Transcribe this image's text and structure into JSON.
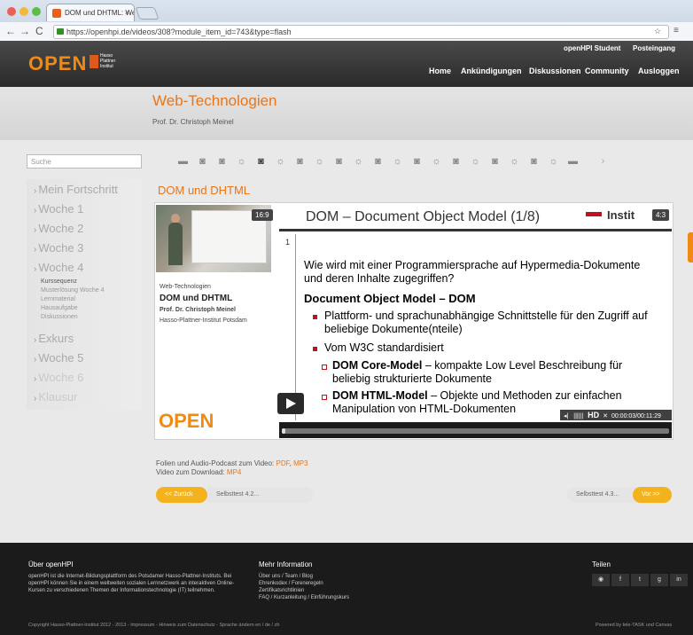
{
  "browser": {
    "tab_title": "DOM und DHTML: Web-T…",
    "url": "https://openhpi.de/videos/308?module_item_id=743&type=flash"
  },
  "header": {
    "logo": "OPEN",
    "hpi_lines": [
      "Hasso",
      "Plattner",
      "Institut"
    ],
    "top_links": [
      "openHPI Student",
      "Posteingang"
    ],
    "nav": [
      "Home",
      "Ankündigungen",
      "Diskussionen",
      "Community",
      "Ausloggen"
    ]
  },
  "course": {
    "title": "Web-Technologien",
    "professor": "Prof. Dr. Christoph Meinel"
  },
  "sidebar": {
    "search_placeholder": "Suche",
    "items": [
      "Mein Fortschritt",
      "Woche 1",
      "Woche 2",
      "Woche 3",
      "Woche 4",
      "Exkurs",
      "Woche 5",
      "Woche 6",
      "Klausur"
    ],
    "subitems": [
      "Kurssequenz",
      "Musterlösung Woche 4",
      "Lernmaterial",
      "Hausaufgabe",
      "Diskussionen"
    ]
  },
  "lesson": {
    "heading": "DOM und DHTML",
    "badge_video": "16:9",
    "badge_slide": "4:3",
    "meta_course": "Web-Technologien",
    "meta_title": "DOM und DHTML",
    "meta_prof": "Prof. Dr. Christoph Meinel",
    "meta_inst": "Hasso-Plattner-Institut Potsdam"
  },
  "slide": {
    "title": "DOM – Document Object Model (1/8)",
    "institute": "Instit",
    "page": "1",
    "intro": "Wie wird mit einer Programmiersprache auf Hypermedia-Dokumente und deren Inhalte zugegriffen?",
    "heading": "Document Object Model – DOM",
    "b1": "Plattform- und sprachunabhängige Schnittstelle für den Zugriff auf beliebige Dokumente(nteile)",
    "b2": "Vom W3C standardisiert",
    "s1_bold": "DOM Core-Model",
    "s1_rest": " – kompakte Low Level Beschreibung für beliebig strukturierte Dokumente",
    "s2_bold": "DOM HTML-Model",
    "s2_rest": " – Objekte und Methoden zur einfachen Manipulation von HTML-Dokumenten"
  },
  "player": {
    "hd": "HD",
    "time": "00:00:03/00:11:29",
    "progress": 0.004
  },
  "downloads": {
    "podcast_label": "Folien und Audio-Podcast zum Video: ",
    "pdf": "PDF",
    "mp3": "MP3",
    "video_label": "Video zum Download: ",
    "mp4": "MP4"
  },
  "pager": {
    "back": "<< Zurück",
    "prev_item": "Selbsttest 4.2...",
    "next_item": "Selbsttest 4.3...",
    "forward": "Vor >>"
  },
  "footer": {
    "about_title": "Über openHPI",
    "about_text": "openHPI ist die Internet-Bildungsplattform des Potsdamer Hasso-Plattner-Instituts. Bei openHPI können Sie in einem weltweiten sozialen Lernnetzwerk an interaktiven Online-Kursen zu verschiedenen Themen der Informationstechnologie (IT) teilnehmen.",
    "more_title": "Mehr Information",
    "more_links": [
      "Über uns / Team / Blog",
      "Ehrenkodex / Foreneregeln",
      "Zertifikatsrichtlinien",
      "FAQ / Kurzanleitung / Einführungskurs"
    ],
    "share_title": "Teilen",
    "copyright": "Copyright Hasso-Plattner-Institut 2012 - 2013 - Impressum - Hinweis zum Datenschutz - Sprache ändern en / de / zh",
    "powered": "Powered by tele-TASK und Canvas"
  }
}
